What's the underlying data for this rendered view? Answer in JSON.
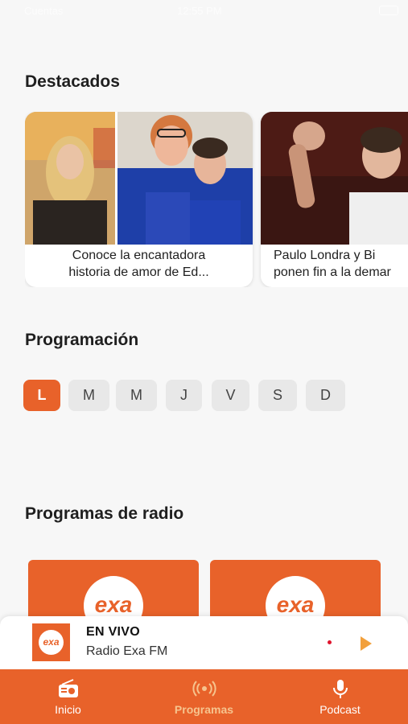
{
  "status_bar": {
    "carrier": "Cuentas",
    "time": "12:55 PM"
  },
  "sections": {
    "featured_title": "Destacados",
    "schedule_title": "Programación",
    "radio_title": "Programas de radio"
  },
  "featured": [
    {
      "caption_line1": "Conoce la encantadora",
      "caption_line2": "historia de amor de Ed..."
    },
    {
      "caption_line1": "Paulo Londra y Bi",
      "caption_line2": "ponen fin a la demar"
    }
  ],
  "days": [
    {
      "label": "L",
      "active": true
    },
    {
      "label": "M",
      "active": false
    },
    {
      "label": "M",
      "active": false
    },
    {
      "label": "J",
      "active": false
    },
    {
      "label": "V",
      "active": false
    },
    {
      "label": "S",
      "active": false
    },
    {
      "label": "D",
      "active": false
    }
  ],
  "programs": [
    {
      "logo_text": "exa"
    },
    {
      "logo_text": "exa"
    }
  ],
  "player": {
    "logo_text": "exa",
    "status": "EN VIVO",
    "station": "Radio Exa FM",
    "play_icon": "play-icon"
  },
  "tabbar": {
    "items": [
      {
        "label": "Inicio",
        "icon": "radio-icon",
        "active": false
      },
      {
        "label": "Programas",
        "icon": "broadcast-icon",
        "active": true
      },
      {
        "label": "Podcast",
        "icon": "microphone-icon",
        "active": false
      }
    ]
  },
  "colors": {
    "accent": "#e8622a",
    "active_tab_text": "#f6c48e",
    "live_dot": "#e0142d"
  }
}
